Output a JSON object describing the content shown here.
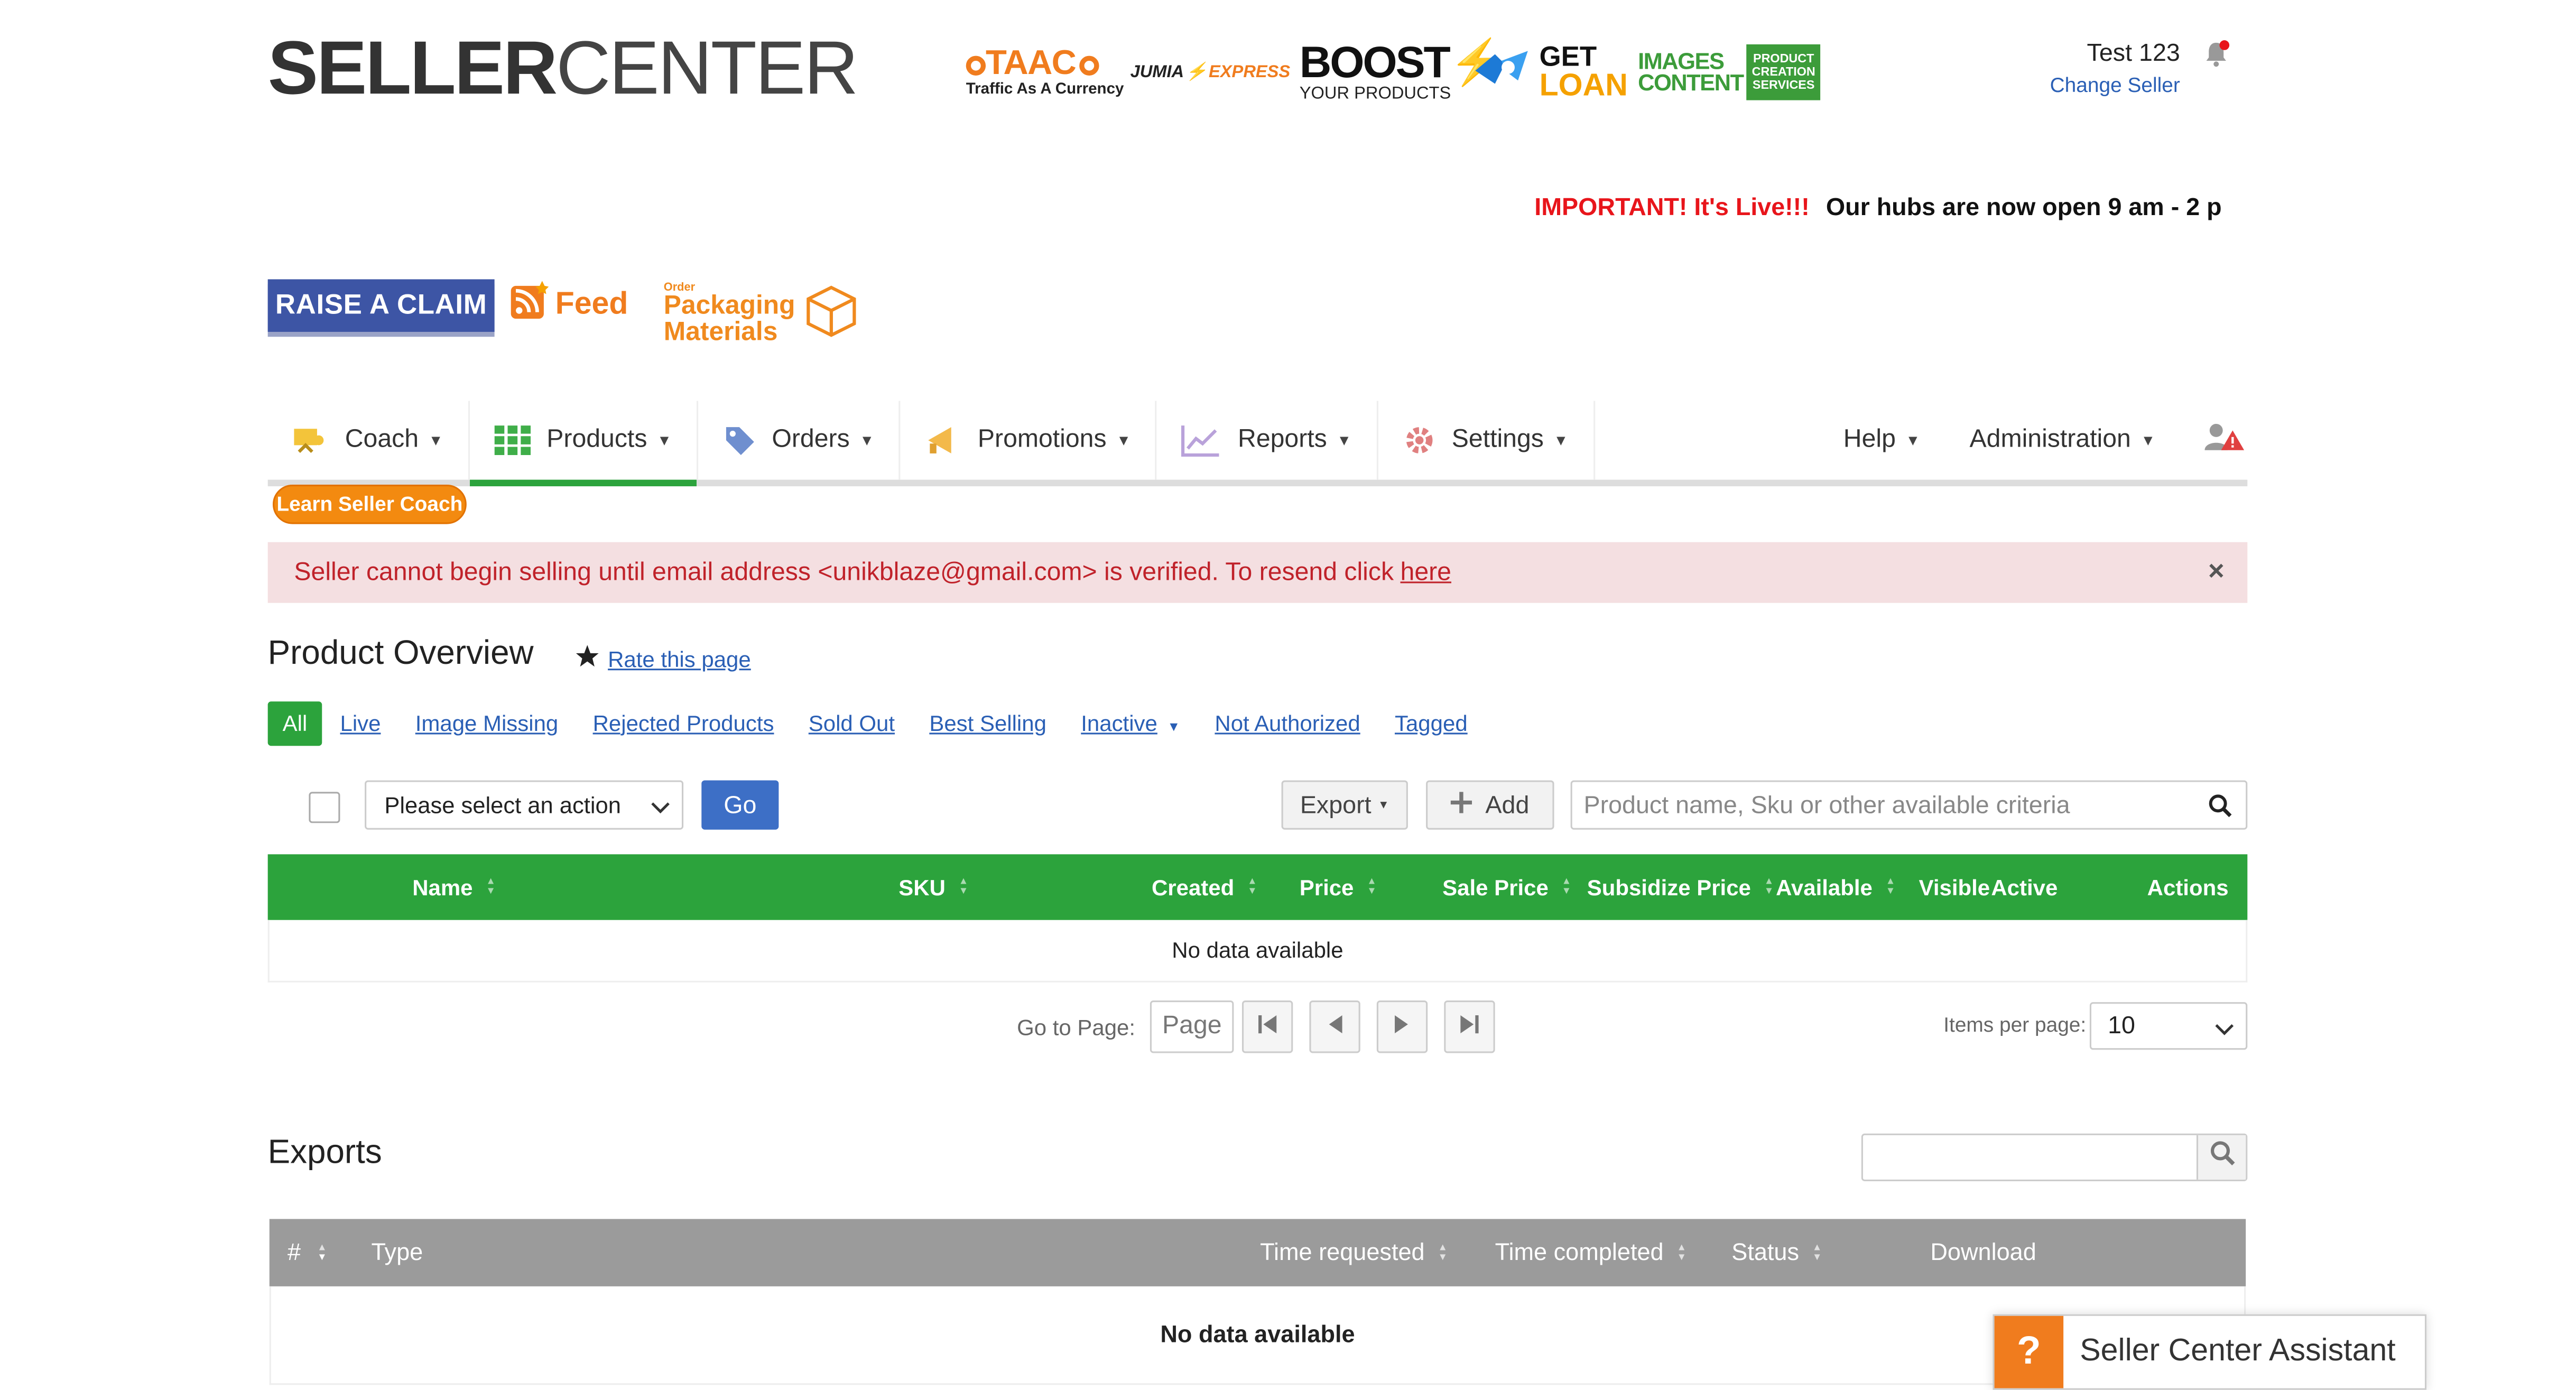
{
  "header": {
    "logo_bold": "SELLER",
    "logo_light": "CENTER",
    "partners": [
      {
        "id": "taac",
        "line1": "TAAC",
        "line2": "Traffic As A Currency"
      },
      {
        "id": "jumia",
        "line1": "JUMIA",
        "line2": "EXPRESS"
      },
      {
        "id": "boost",
        "line1": "BOOST",
        "line2": "YOUR PRODUCTS"
      },
      {
        "id": "loan",
        "line1": "GET",
        "line2": "LOAN"
      },
      {
        "id": "images",
        "line1": "IMAGES",
        "line2": "CONTENT",
        "side": "PRODUCT CREATION SERVICES"
      }
    ],
    "user_name": "Test 123",
    "change_seller": "Change Seller"
  },
  "ticker": {
    "important": "IMPORTANT! It's Live!!!",
    "message": "Our hubs are now open 9 am - 2 p"
  },
  "banners": {
    "raise_claim": "RAISE A CLAIM",
    "feed": "Feed",
    "pack_small": "Order",
    "pack_line1": "Packaging",
    "pack_line2": "Materials"
  },
  "nav": {
    "items": [
      {
        "label": "Coach",
        "icon": "coach-icon"
      },
      {
        "label": "Products",
        "icon": "grid-icon"
      },
      {
        "label": "Orders",
        "icon": "tag-icon"
      },
      {
        "label": "Promotions",
        "icon": "megaphone-icon"
      },
      {
        "label": "Reports",
        "icon": "chart-icon"
      },
      {
        "label": "Settings",
        "icon": "gear-icon"
      }
    ],
    "right": [
      {
        "label": "Help"
      },
      {
        "label": "Administration"
      }
    ],
    "active": "Products"
  },
  "coach_pill": "Learn Seller Coach",
  "alert": {
    "text": "Seller cannot begin selling until email address <unikblaze@gmail.com> is verified. To resend click",
    "link": "here",
    "close": "×"
  },
  "overview": {
    "title": "Product Overview",
    "rate": "Rate this page",
    "tabs": [
      "All",
      "Live",
      "Image Missing",
      "Rejected Products",
      "Sold Out",
      "Best Selling",
      "Inactive",
      "Not Authorized",
      "Tagged"
    ]
  },
  "toolbar": {
    "action_select": "Please select an action",
    "go": "Go",
    "export": "Export",
    "add": "Add",
    "search_placeholder": "Product name, Sku or other available criteria"
  },
  "products_table": {
    "columns": [
      "Name",
      "SKU",
      "Created",
      "Price",
      "Sale Price",
      "Subsidize Price",
      "Available",
      "Visible",
      "Active",
      "Actions"
    ],
    "empty": "No data available"
  },
  "pagination": {
    "go_to_page": "Go to Page:",
    "page_placeholder": "Page",
    "items_per_page": "Items per page:",
    "items_value": "10"
  },
  "exports": {
    "title": "Exports",
    "columns": [
      "#",
      "Type",
      "Time requested",
      "Time completed",
      "Status",
      "Download"
    ],
    "empty": "No data available"
  },
  "assistant": {
    "q": "?",
    "label": "Seller Center Assistant"
  },
  "colors": {
    "green": "#2ca33c",
    "blue": "#3d6fc6",
    "orange": "#f07c1e",
    "alert_bg": "#f4dfe1",
    "alert_text": "#c0222a"
  }
}
